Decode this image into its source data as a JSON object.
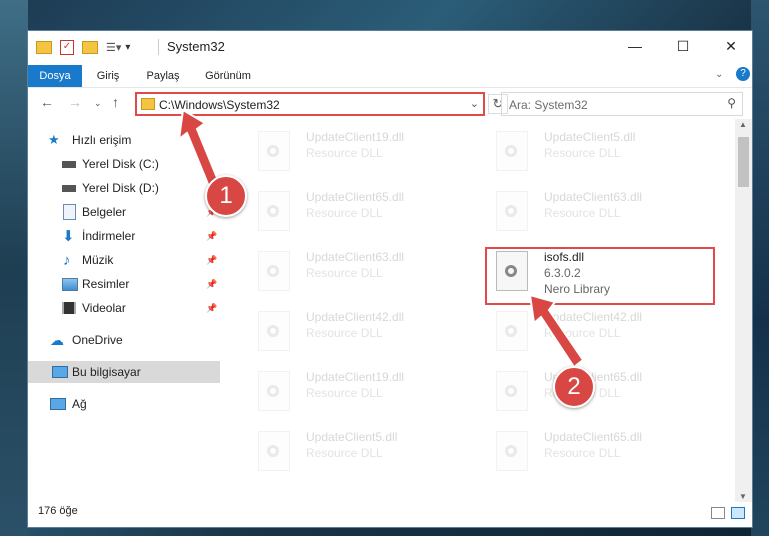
{
  "window": {
    "title": "System32"
  },
  "ribbon": {
    "tabs": [
      "Dosya",
      "Giriş",
      "Paylaş",
      "Görünüm"
    ]
  },
  "address": {
    "path": "C:\\Windows\\System32"
  },
  "search": {
    "placeholder": "Ara: System32"
  },
  "sidebar": {
    "quick_access": "Hızlı erişim",
    "items": [
      "Yerel Disk (C:)",
      "Yerel Disk (D:)",
      "Belgeler",
      "İndirmeler",
      "Müzik",
      "Resimler",
      "Videolar"
    ],
    "onedrive": "OneDrive",
    "this_pc": "Bu bilgisayar",
    "network": "Ağ"
  },
  "files": [
    {
      "name": "UpdateClient19.dll",
      "type": "Resource DLL"
    },
    {
      "name": "UpdateClient5.dll",
      "type": "Resource DLL"
    },
    {
      "name": "UpdateClient65.dll",
      "type": "Resource DLL"
    },
    {
      "name": "UpdateClient63.dll",
      "type": "Resource DLL"
    },
    {
      "name": "UpdateClient63.dll",
      "type": "Resource DLL"
    },
    {
      "name": "UpdateClient42.dll",
      "type": "Resource DLL"
    },
    {
      "name": "UpdateClient42.dll",
      "type": "Resource DLL"
    },
    {
      "name": "UpdateClient19.dll",
      "type": "Resource DLL"
    },
    {
      "name": "UpdateClient65.dll",
      "type": "Resource DLL"
    },
    {
      "name": "UpdateClient5.dll",
      "type": "Resource DLL"
    },
    {
      "name": "UpdateClient65.dll",
      "type": "Resource DLL"
    }
  ],
  "highlight_file": {
    "name": "isofs.dll",
    "version": "6.3.0.2",
    "description": "Nero Library"
  },
  "status": {
    "count": "176 öğe"
  },
  "markers": {
    "one": "1",
    "two": "2"
  },
  "colors": {
    "accent": "#1979ca",
    "highlight": "#e04b49",
    "marker": "#d94744"
  }
}
